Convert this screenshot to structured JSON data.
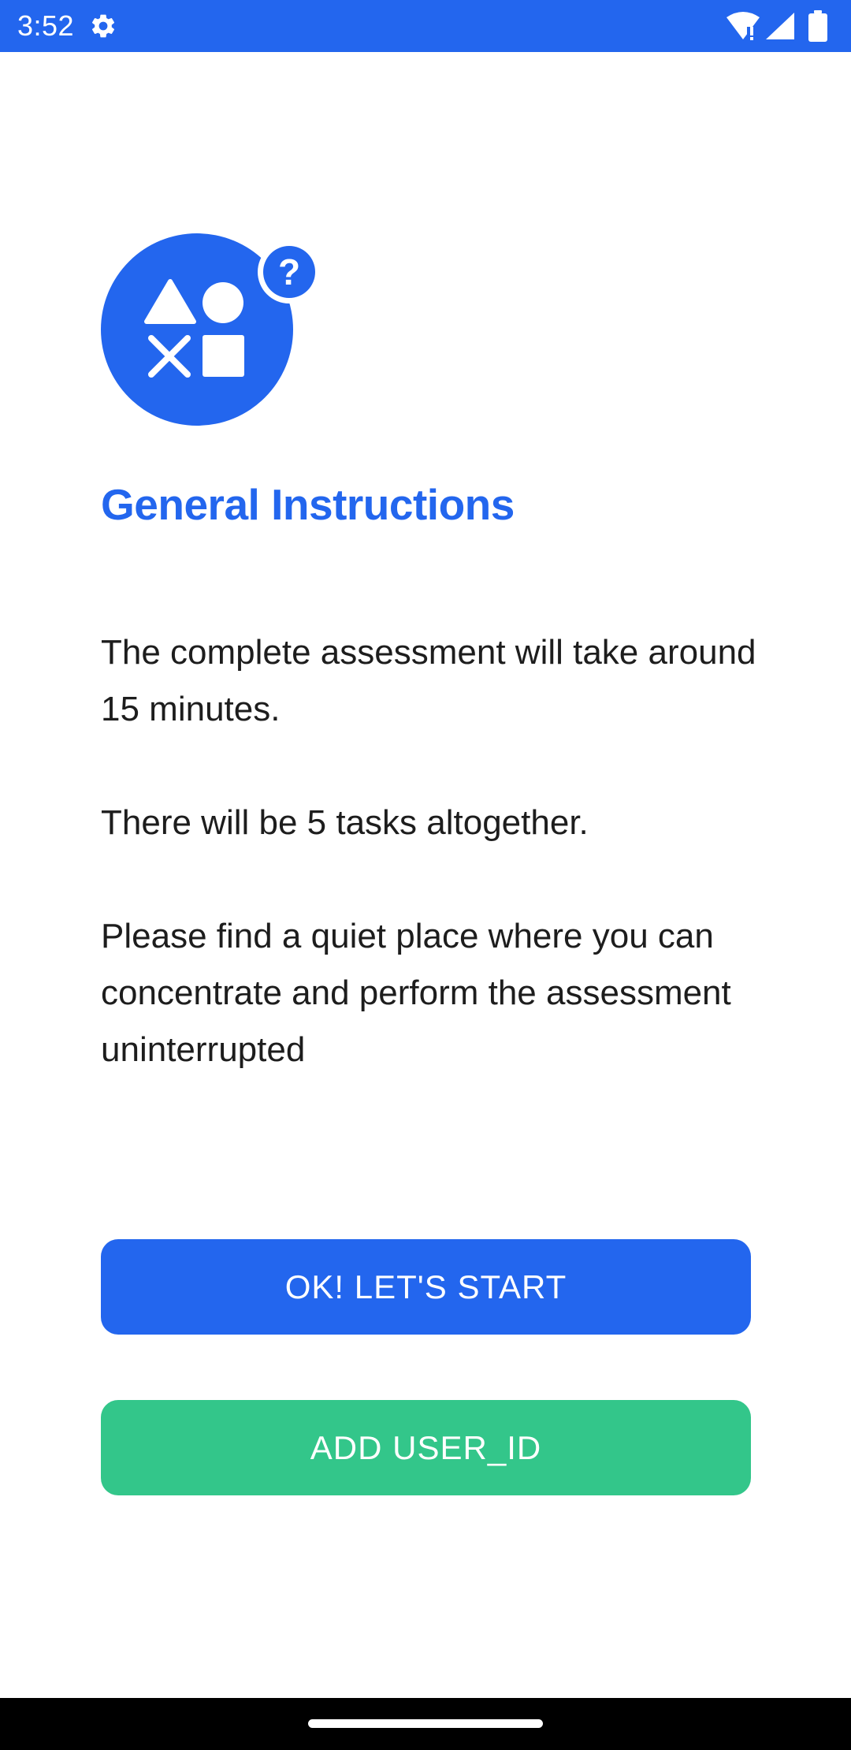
{
  "status_bar": {
    "time": "3:52",
    "icons": [
      "gear-icon",
      "wifi-icon",
      "cell-signal-icon",
      "battery-icon"
    ],
    "background": "#2366ee"
  },
  "illustration": {
    "icon": "shapes-question-icon",
    "color": "#2366ee"
  },
  "title": "General Instructions",
  "paragraphs": [
    "The complete assessment will take around 15 minutes.",
    "There will be 5 tasks altogether.",
    "Please find a quiet place where you can concentrate and perform the assessment uninterrupted"
  ],
  "buttons": {
    "start_label": "OK! LET'S START",
    "start_color": "#2366ee",
    "add_user_label": "ADD USER_ID",
    "add_user_color": "#33c68a"
  },
  "colors": {
    "accent": "#2366ee",
    "success": "#33c68a",
    "text": "#1d1d1d"
  }
}
